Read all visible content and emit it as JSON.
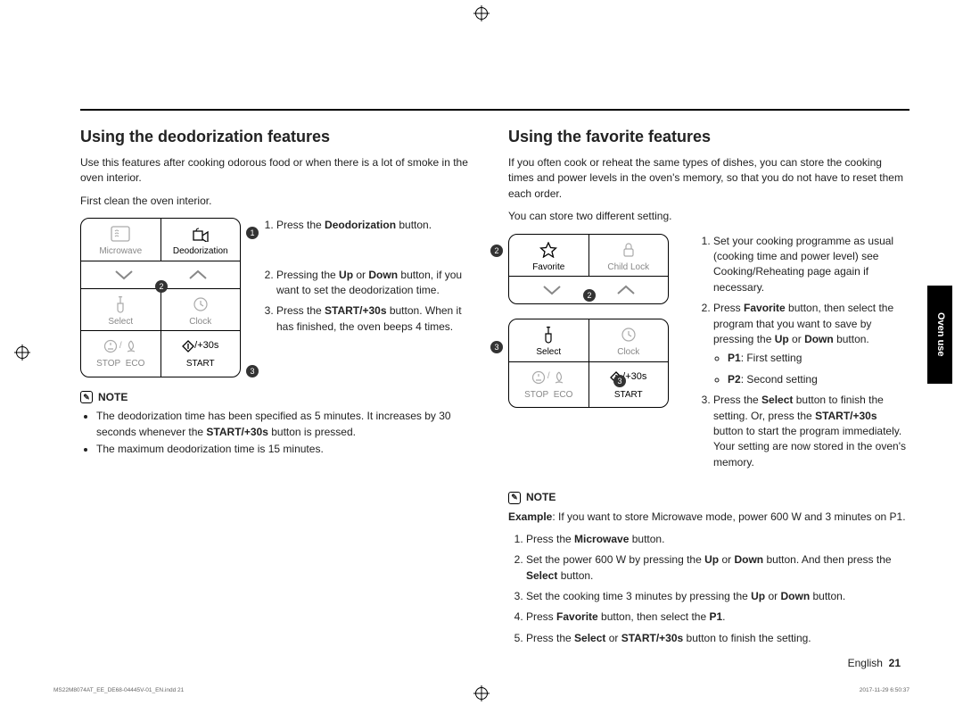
{
  "left": {
    "heading": "Using the deodorization features",
    "intro": "Use this features after cooking odorous food or when there is a lot of smoke in the oven interior.",
    "prep": "First clean the oven interior.",
    "panel": {
      "microwave": "Microwave",
      "deodorization": "Deodorization",
      "select": "Select",
      "clock": "Clock",
      "stop": "STOP",
      "eco": "ECO",
      "start": "START",
      "plus30": "/+30s"
    },
    "step1": "Press the ",
    "step1b": "Deodorization",
    "step1c": " button.",
    "step2a": "Pressing the ",
    "step2b": "Up",
    "step2c": " or ",
    "step2d": "Down",
    "step2e": " button, if you want to set the deodorization time.",
    "step3a": "Press the ",
    "step3b": "START/+30s",
    "step3c": " button. When it has finished, the oven beeps 4 times.",
    "note_label": "NOTE",
    "note1a": "The deodorization time has been specified as 5 minutes. It increases by 30 seconds whenever the ",
    "note1b": "START/+30s",
    "note1c": " button is pressed.",
    "note2": "The maximum deodorization time is 15 minutes."
  },
  "right": {
    "heading": "Using the favorite features",
    "intro": "If you often cook or reheat the same types of dishes, you can store the cooking times and power levels in the oven's memory, so that you do not have to reset them each order.",
    "sub": "You can store two different setting.",
    "panel1": {
      "favorite": "Favorite",
      "childlock": "Child Lock"
    },
    "panel2": {
      "select": "Select",
      "clock": "Clock",
      "stop": "STOP",
      "eco": "ECO",
      "start": "START",
      "plus30": "/+30s"
    },
    "step1": "Set your cooking programme as usual (cooking time and power level) see Cooking/Reheating page again if necessary.",
    "step2a": "Press ",
    "step2b": "Favorite",
    "step2c": " button, then select the program that you want to save by pressing the ",
    "step2d": "Up",
    "step2e": " or ",
    "step2f": "Down",
    "step2g": " button.",
    "p1a": "P1",
    "p1b": ": First setting",
    "p2a": "P2",
    "p2b": ": Second setting",
    "step3a": "Press the ",
    "step3b": "Select",
    "step3c": " button to finish the setting. Or, press the ",
    "step3d": "START/+30s",
    "step3e": " button to start the program immediately.",
    "step3f": "Your setting are now stored in the oven's memory.",
    "note_label": "NOTE",
    "examplea": "Example",
    "exampleb": ": If you want to store Microwave mode, power 600 W and 3 minutes on P1.",
    "ex1a": "Press the ",
    "ex1b": "Microwave",
    "ex1c": " button.",
    "ex2a": "Set the power 600 W by pressing the ",
    "ex2b": "Up",
    "ex2c": " or ",
    "ex2d": "Down",
    "ex2e": " button. And then press the ",
    "ex2f": "Select",
    "ex2g": " button.",
    "ex3a": "Set the cooking time 3 minutes by pressing the ",
    "ex3b": "Up",
    "ex3c": " or ",
    "ex3d": "Down",
    "ex3e": " button.",
    "ex4a": "Press ",
    "ex4b": "Favorite",
    "ex4c": " button, then select the ",
    "ex4d": "P1",
    "ex4e": ".",
    "ex5a": "Press the ",
    "ex5b": "Select",
    "ex5c": " or ",
    "ex5d": "START/+30s",
    "ex5e": " button to finish the setting."
  },
  "side_tab": "Oven use",
  "footer_lang": "English",
  "footer_page": "21",
  "microfooter_left": "MS22M8074AT_EE_DE68-04445V-01_EN.indd   21",
  "microfooter_right": "2017-11-29   6:50:37"
}
